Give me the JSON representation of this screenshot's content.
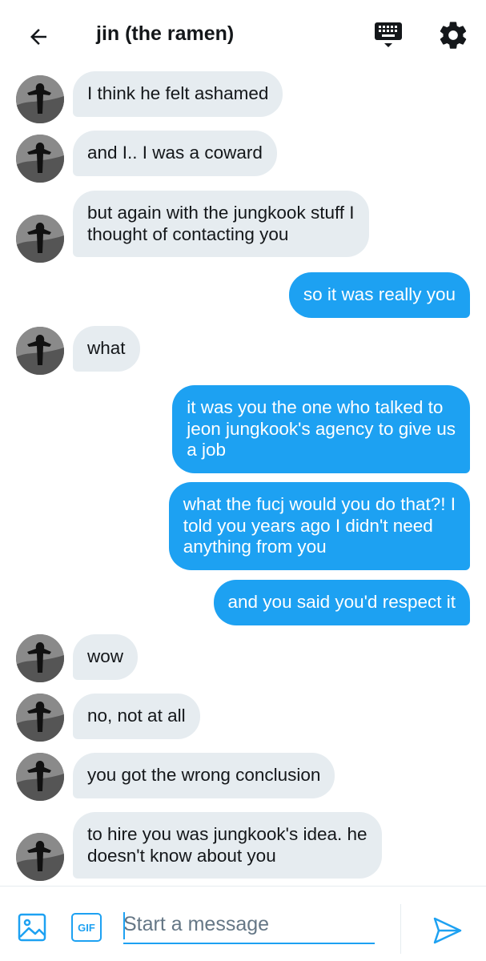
{
  "header": {
    "title": "jin (the ramen)",
    "icons": [
      "back-arrow-icon",
      "keyboard-icon",
      "gear-icon"
    ]
  },
  "messages": [
    {
      "side": "in",
      "text": "I think he felt ashamed"
    },
    {
      "side": "in",
      "text": "and I.. I was a coward"
    },
    {
      "side": "in",
      "text": "but again with the jungkook stuff I\nthought of contacting you"
    },
    {
      "side": "out",
      "text": "so it was really you"
    },
    {
      "side": "in",
      "text": "what"
    },
    {
      "side": "out",
      "text": "it was you the one who talked to\njeon jungkook's agency to give us\na job"
    },
    {
      "side": "out",
      "text": "what the fucj would you do that?! I\ntold you years ago I didn't need\nanything from you"
    },
    {
      "side": "out",
      "text": "and you said you'd respect it"
    },
    {
      "side": "in",
      "text": "wow"
    },
    {
      "side": "in",
      "text": "no, not at all"
    },
    {
      "side": "in",
      "text": "you got the wrong conclusion"
    },
    {
      "side": "in",
      "text": "to hire you was jungkook's idea. he\ndoesn't know about you"
    }
  ],
  "composer": {
    "placeholder": "Start a message",
    "value": "",
    "gif_label": "GIF",
    "icons": [
      "image-icon",
      "gif-icon",
      "send-icon"
    ]
  },
  "colors": {
    "accent": "#1da1f2",
    "incoming_bubble": "#e6ecf0",
    "text": "#14171a",
    "placeholder": "#657786"
  }
}
